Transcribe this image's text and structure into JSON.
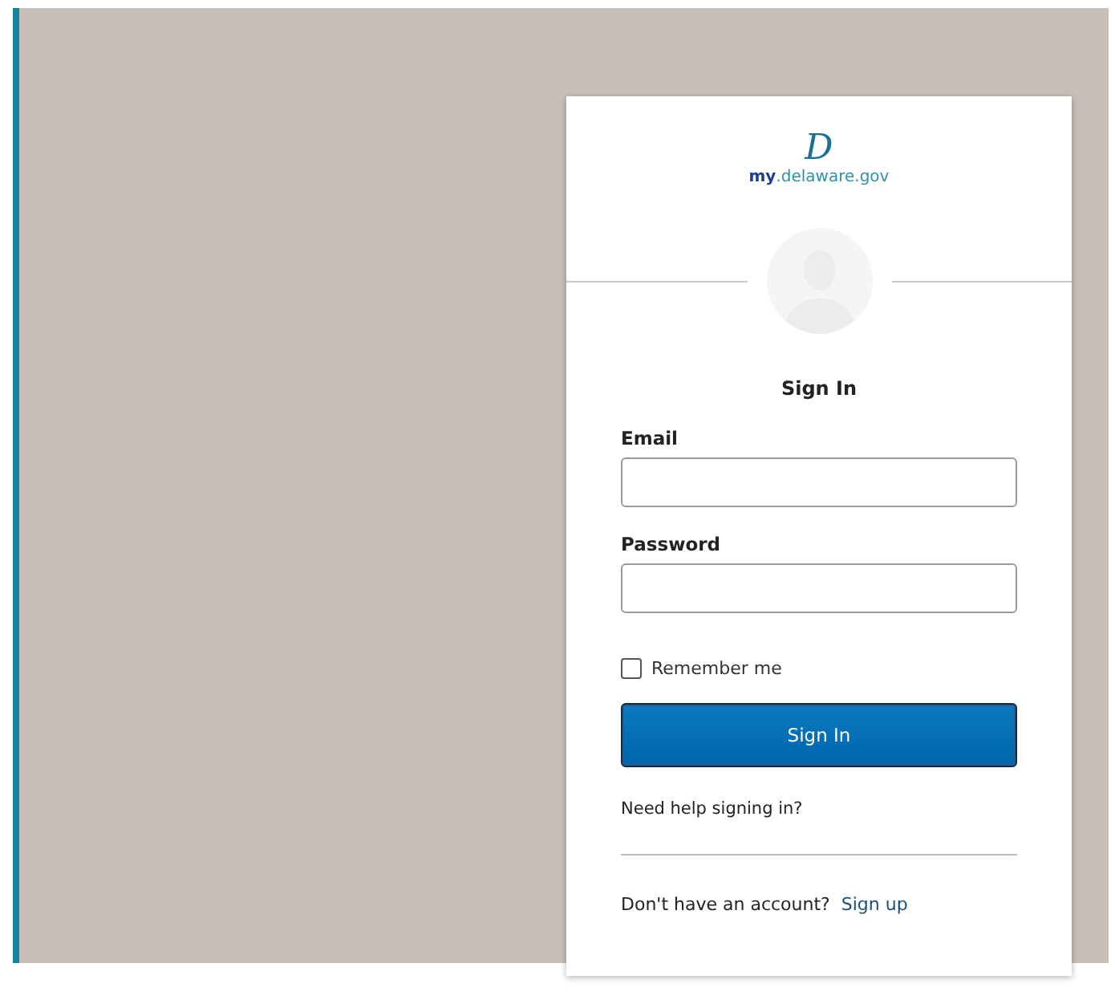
{
  "logo": {
    "mark": "D",
    "prefix": "my",
    "domain": ".delaware.gov"
  },
  "title": "Sign In",
  "fields": [
    {
      "label": "Email"
    },
    {
      "label": "Password"
    }
  ],
  "remember": {
    "label": "Remember me",
    "checked": false
  },
  "submit": "Sign In",
  "help_link": "Need help signing in?",
  "footer": {
    "text": "Don't have an account?",
    "link": "Sign up"
  }
}
